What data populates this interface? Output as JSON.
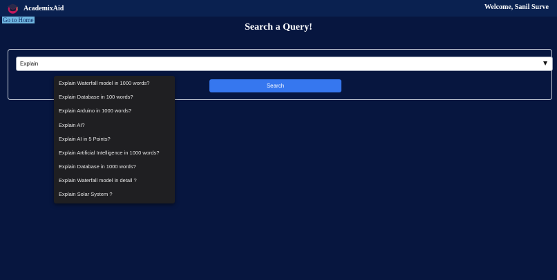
{
  "navbar": {
    "brand_name": "AcademixAid",
    "logo_icon": "graduation-cap-icon",
    "welcome_text": "Welcome, Sanil Surve"
  },
  "home_link": "Go to Home",
  "page_title": "Search a Query!",
  "query": {
    "value": "Explain",
    "dropdown_icon": "triangle-down-icon"
  },
  "search_button": "Search",
  "suggestions": [
    "Explain Waterfall model in 1000 words?",
    "Explain Database in 100 words?",
    "Explain Arduino in 1000 words?",
    "Explain AI?",
    "Explain AI in 5 Points?",
    "Explain Artificial Intelligence in 1000 words?",
    "Explain Database in 1000 words?",
    "Explain Waterfall model in detail ?",
    "Explain Solar System ?"
  ],
  "colors": {
    "page_background": "#07163f",
    "navbar_background": "#0a2150",
    "accent_button": "#3677ef",
    "home_link_highlight": "#6fb6e0",
    "dropdown_background": "#1f1f22"
  }
}
